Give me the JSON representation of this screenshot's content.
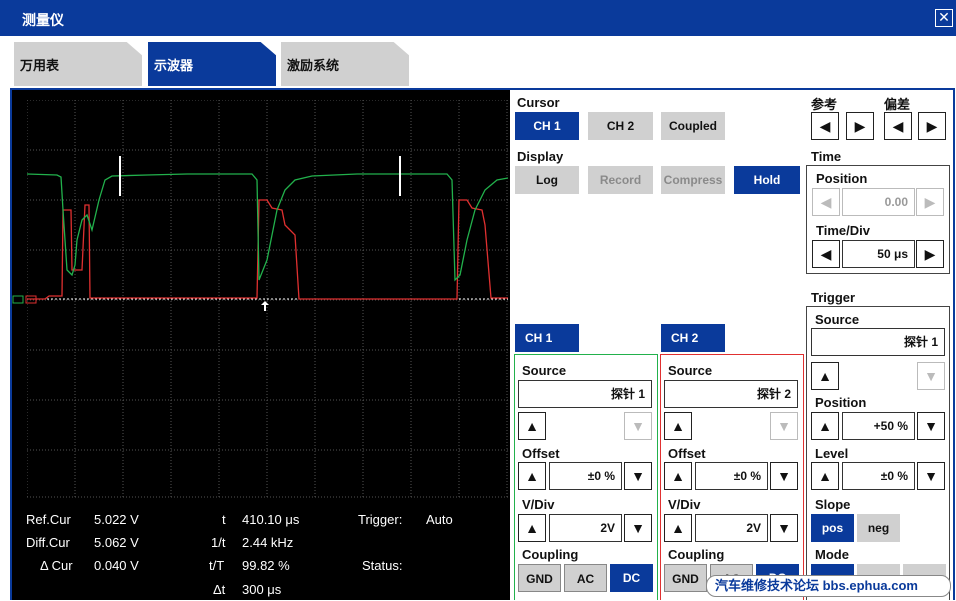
{
  "window": {
    "title": "测量仪"
  },
  "tabs": [
    {
      "label": "万用表"
    },
    {
      "label": "示波器"
    },
    {
      "label": "激励系统"
    }
  ],
  "readouts": {
    "ref_cur_label": "Ref.Cur",
    "ref_cur_value": "5.022 V",
    "diff_cur_label": "Diff.Cur",
    "diff_cur_value": "5.062 V",
    "delta_cur_label": "Δ Cur",
    "delta_cur_value": "0.040 V",
    "t_label": "t",
    "t_value": "410.10 μs",
    "inv_t_label": "1/t",
    "inv_t_value": "2.44 kHz",
    "t_over_T_label": "t/T",
    "t_over_T_value": "99.82 %",
    "delta_t_label": "Δt",
    "delta_t_value": "300 μs",
    "trigger_label": "Trigger:",
    "trigger_value": "Auto",
    "status_label": "Status:"
  },
  "cursor": {
    "label": "Cursor",
    "ch1": "CH 1",
    "ch2": "CH 2",
    "coupled": "Coupled"
  },
  "display": {
    "label": "Display",
    "log": "Log",
    "record": "Record",
    "compress": "Compress",
    "hold": "Hold"
  },
  "ref_dev": {
    "ref_label": "参考",
    "dev_label": "偏差"
  },
  "time": {
    "label": "Time",
    "position_label": "Position",
    "position_value": "0.00",
    "timediv_label": "Time/Div",
    "timediv_value": "50 μs"
  },
  "trigger": {
    "label": "Trigger",
    "source_label": "Source",
    "source_value": "探针 1",
    "position_label": "Position",
    "position_value": "+50 %",
    "level_label": "Level",
    "level_value": "±0 %",
    "slope_label": "Slope",
    "slope_pos": "pos",
    "slope_neg": "neg",
    "mode_label": "Mode"
  },
  "ch1": {
    "header": "CH 1",
    "source_label": "Source",
    "source_value": "探针 1",
    "offset_label": "Offset",
    "offset_value": "±0 %",
    "vdiv_label": "V/Div",
    "vdiv_value": "2V",
    "coupling_label": "Coupling",
    "gnd": "GND",
    "ac": "AC",
    "dc": "DC"
  },
  "ch2": {
    "header": "CH 2",
    "source_label": "Source",
    "source_value": "探针 2",
    "offset_label": "Offset",
    "offset_value": "±0 %",
    "vdiv_label": "V/Div",
    "vdiv_value": "2V",
    "coupling_label": "Coupling",
    "gnd": "GND",
    "ac": "AC",
    "dc": "DC"
  },
  "watermark": "汽车维修技术论坛 bbs.ephua.com",
  "colors": {
    "accent": "#0a3a9b",
    "ch1_trace": "#22b14c",
    "ch2_trace": "#e03030",
    "screen": "#000000"
  }
}
